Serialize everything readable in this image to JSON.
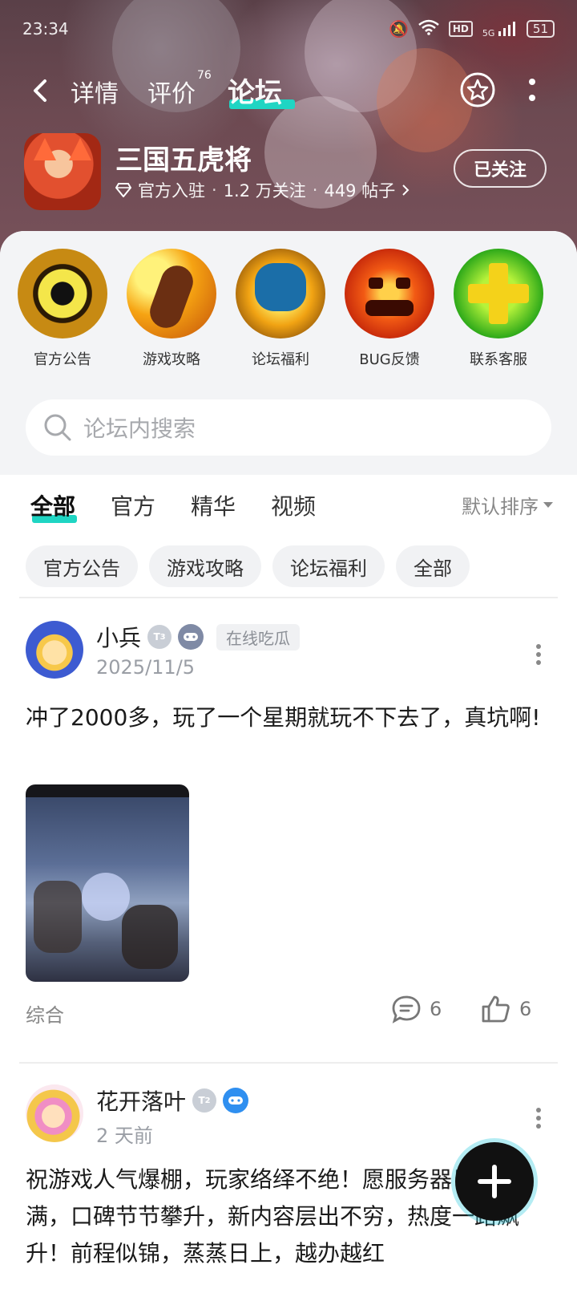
{
  "status_bar": {
    "time": "23:34",
    "network": "5G",
    "hd": "HD",
    "battery": "51"
  },
  "nav": {
    "tabs": [
      {
        "label": "详情"
      },
      {
        "label": "评价",
        "count": "76"
      },
      {
        "label": "论坛"
      }
    ],
    "active_tab": "论坛"
  },
  "game": {
    "title": "三国五虎将",
    "official": "官方入驻",
    "followers": "1.2 万关注",
    "posts": "449 帖子",
    "follow_label": "已关注"
  },
  "shortcuts": [
    {
      "label": "官方公告",
      "icon": "eye-icon"
    },
    {
      "label": "游戏攻略",
      "icon": "hand-icon"
    },
    {
      "label": "论坛福利",
      "icon": "gift-fist-icon"
    },
    {
      "label": "BUG反馈",
      "icon": "pumpkin-icon"
    },
    {
      "label": "联系客服",
      "icon": "plus-icon"
    }
  ],
  "search": {
    "placeholder": "论坛内搜索"
  },
  "filter_tabs": [
    {
      "label": "全部"
    },
    {
      "label": "官方"
    },
    {
      "label": "精华"
    },
    {
      "label": "视频"
    }
  ],
  "sort_label": "默认排序",
  "chips": [
    {
      "label": "官方公告"
    },
    {
      "label": "游戏攻略"
    },
    {
      "label": "论坛福利"
    },
    {
      "label": "全部"
    }
  ],
  "posts": [
    {
      "user": "小兵",
      "level": "3",
      "title_tag": "在线吃瓜",
      "time": "2025/11/5",
      "text": "冲了2000多，玩了一个星期就玩不下去了，真坑啊!",
      "category": "综合",
      "comments": "6",
      "likes": "6"
    },
    {
      "user": "花开落叶",
      "level": "2",
      "time": "2 天前",
      "text": "祝游戏人气爆棚，玩家络绎不绝！愿服务器日日爆满，口碑节节攀升，新内容层出不穷，热度一路飙升！前程似锦，蒸蒸日上，越办越红"
    }
  ],
  "colors": {
    "accent": "#1fd5c3",
    "banner": "#6d4a52"
  }
}
